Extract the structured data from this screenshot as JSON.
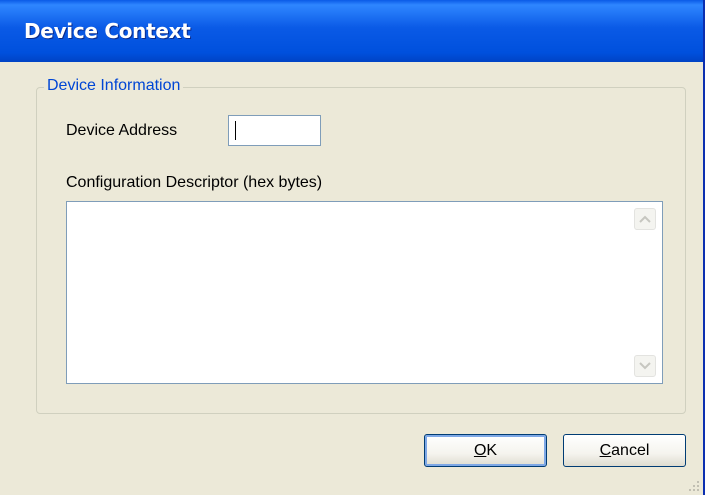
{
  "window": {
    "title": "Device Context"
  },
  "group": {
    "legend": "Device Information"
  },
  "device_address": {
    "label": "Device Address",
    "value": ""
  },
  "config_descriptor": {
    "label": "Configuration Descriptor (hex bytes)",
    "value": ""
  },
  "buttons": {
    "ok_mnemonic": "O",
    "ok_rest": "K",
    "cancel_mnemonic": "C",
    "cancel_rest": "ancel"
  },
  "icons": {
    "scroll_up": "chevron-up-icon",
    "scroll_down": "chevron-down-icon",
    "resize_grip": "resize-grip-icon"
  },
  "colors": {
    "titlebar": "#0a5ae6",
    "dialog_bg": "#ece9d8",
    "group_legend": "#0046d5",
    "input_border": "#7f9db9",
    "button_border": "#003c74"
  }
}
